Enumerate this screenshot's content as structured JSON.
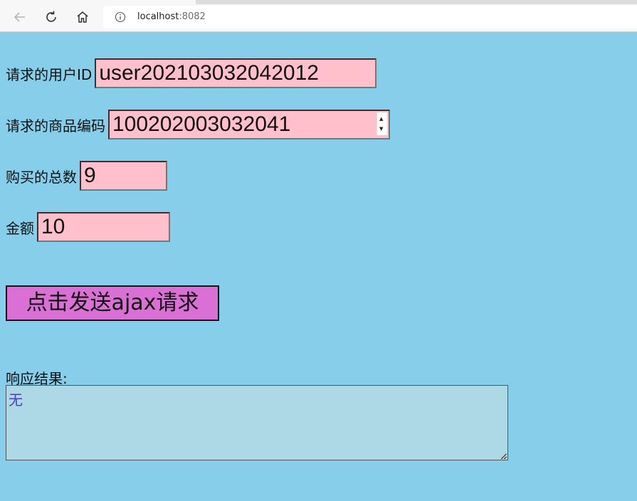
{
  "browser": {
    "url_host": "localhost",
    "url_port": ":8082"
  },
  "form": {
    "user_id": {
      "label": "请求的用户ID",
      "value": "user202103032042012"
    },
    "product_code": {
      "label": "请求的商品编码",
      "value": "100202003032041"
    },
    "quantity": {
      "label": "购买的总数",
      "value": "9"
    },
    "amount": {
      "label": "金额",
      "value": "10"
    },
    "send_button": "点击发送ajax请求"
  },
  "response": {
    "label": "响应结果:",
    "value": "无"
  },
  "colors": {
    "page_bg": "#87ceeb",
    "input_bg": "#ffc0cb",
    "button_bg": "#da70d6",
    "response_bg": "#add8e6",
    "response_text": "#4b3fbf"
  },
  "icons": [
    "back-arrow-icon",
    "reload-icon",
    "home-icon",
    "info-icon",
    "spin-up-icon",
    "spin-down-icon",
    "resize-grip-icon"
  ]
}
